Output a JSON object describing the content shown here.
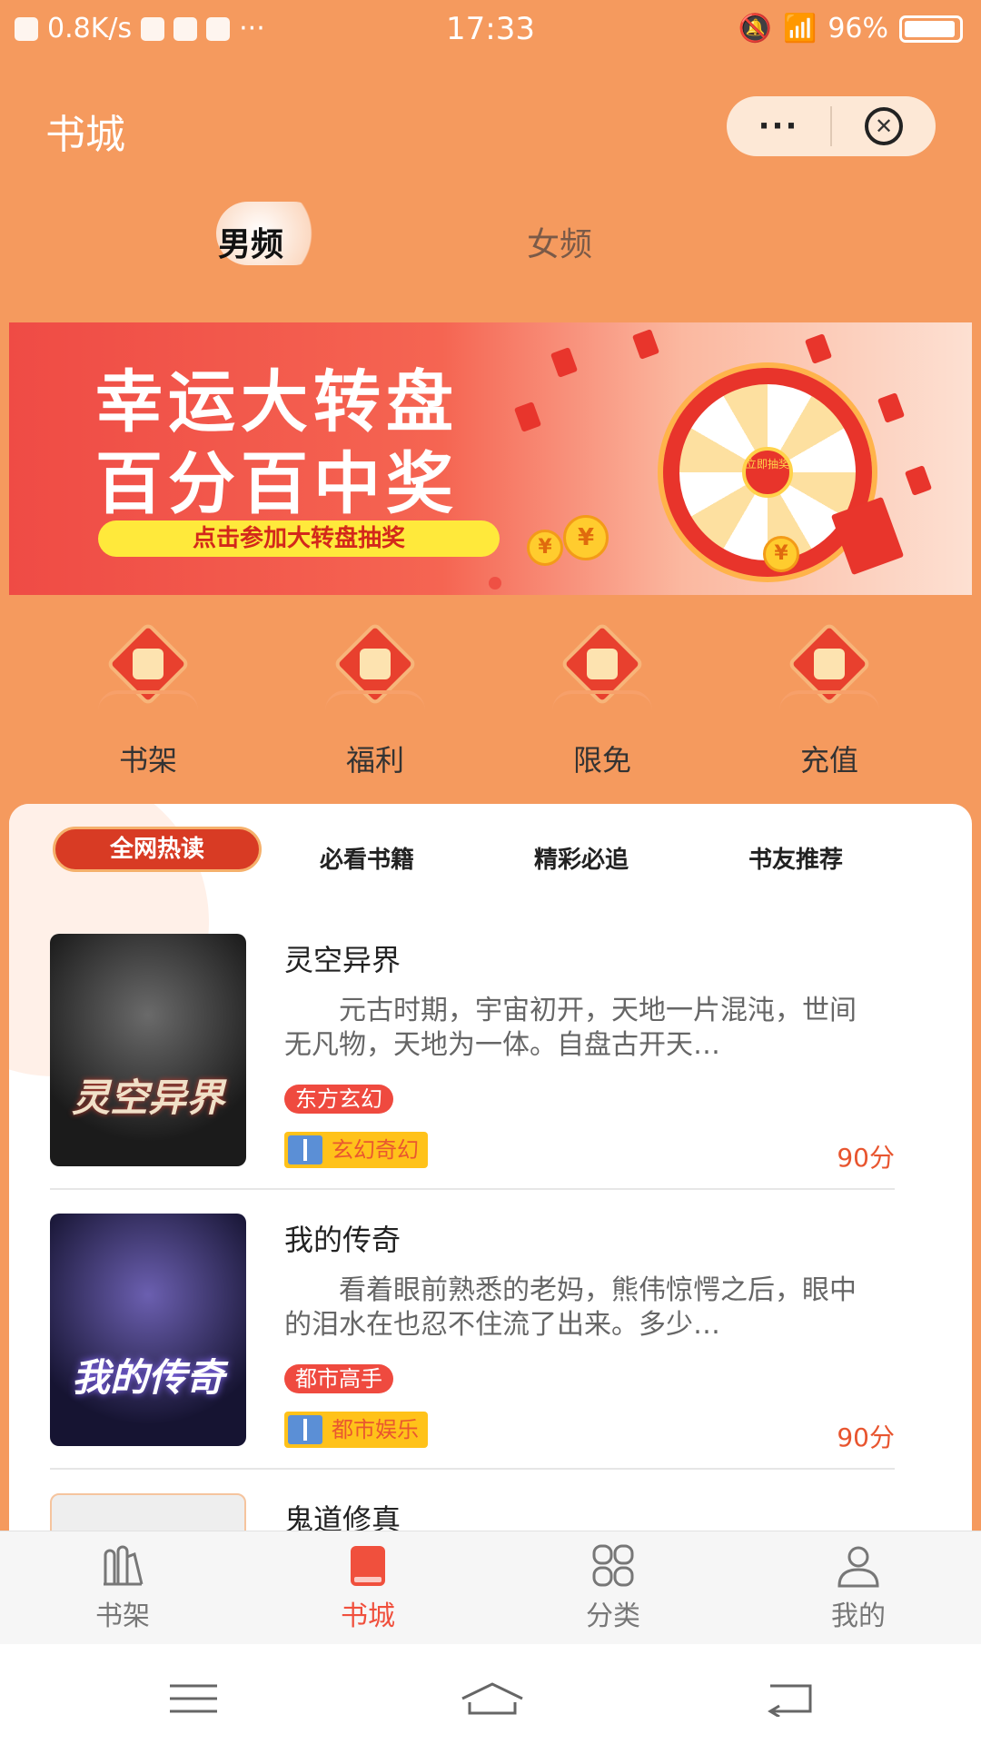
{
  "status": {
    "speed": "0.8K/s",
    "time": "17:33",
    "battery": "96%"
  },
  "header": {
    "title": "书城",
    "more": "···"
  },
  "channels": {
    "male": "男频",
    "female": "女频"
  },
  "banner": {
    "line1": "幸运大转盘",
    "line2": "百分百中奖",
    "cta": "点击参加大转盘抽奖",
    "hub": "立即抽奖",
    "coin": "¥"
  },
  "quick": [
    {
      "label": "书架",
      "icon": "bookshelf-icon"
    },
    {
      "label": "福利",
      "icon": "gift-icon"
    },
    {
      "label": "限免",
      "icon": "gong-icon"
    },
    {
      "label": "充值",
      "icon": "money-bag-icon"
    }
  ],
  "tabs": [
    "全网热读",
    "必看书籍",
    "精彩必追",
    "书友推荐"
  ],
  "books": [
    {
      "title": "灵空异界",
      "cover_text": "灵空异界",
      "desc": "元古时期，宇宙初开，天地一片混沌，世间无凡物，天地为一体。自盘古开天…",
      "tag": "东方玄幻",
      "category": "玄幻奇幻",
      "score": "90分"
    },
    {
      "title": "我的传奇",
      "cover_text": "我的传奇",
      "desc": "看着眼前熟悉的老妈，熊伟惊愕之后，眼中的泪水在也忍不住流了出来。多少…",
      "tag": "都市高手",
      "category": "都市娱乐",
      "score": "90分"
    },
    {
      "title": "鬼道修真"
    }
  ],
  "tabbar": [
    {
      "label": "书架",
      "icon": "bookshelf-icon"
    },
    {
      "label": "书城",
      "icon": "book-icon",
      "active": true
    },
    {
      "label": "分类",
      "icon": "category-icon"
    },
    {
      "label": "我的",
      "icon": "user-icon"
    }
  ],
  "colors": {
    "accent": "#f0503d",
    "background": "#f59a5e"
  }
}
